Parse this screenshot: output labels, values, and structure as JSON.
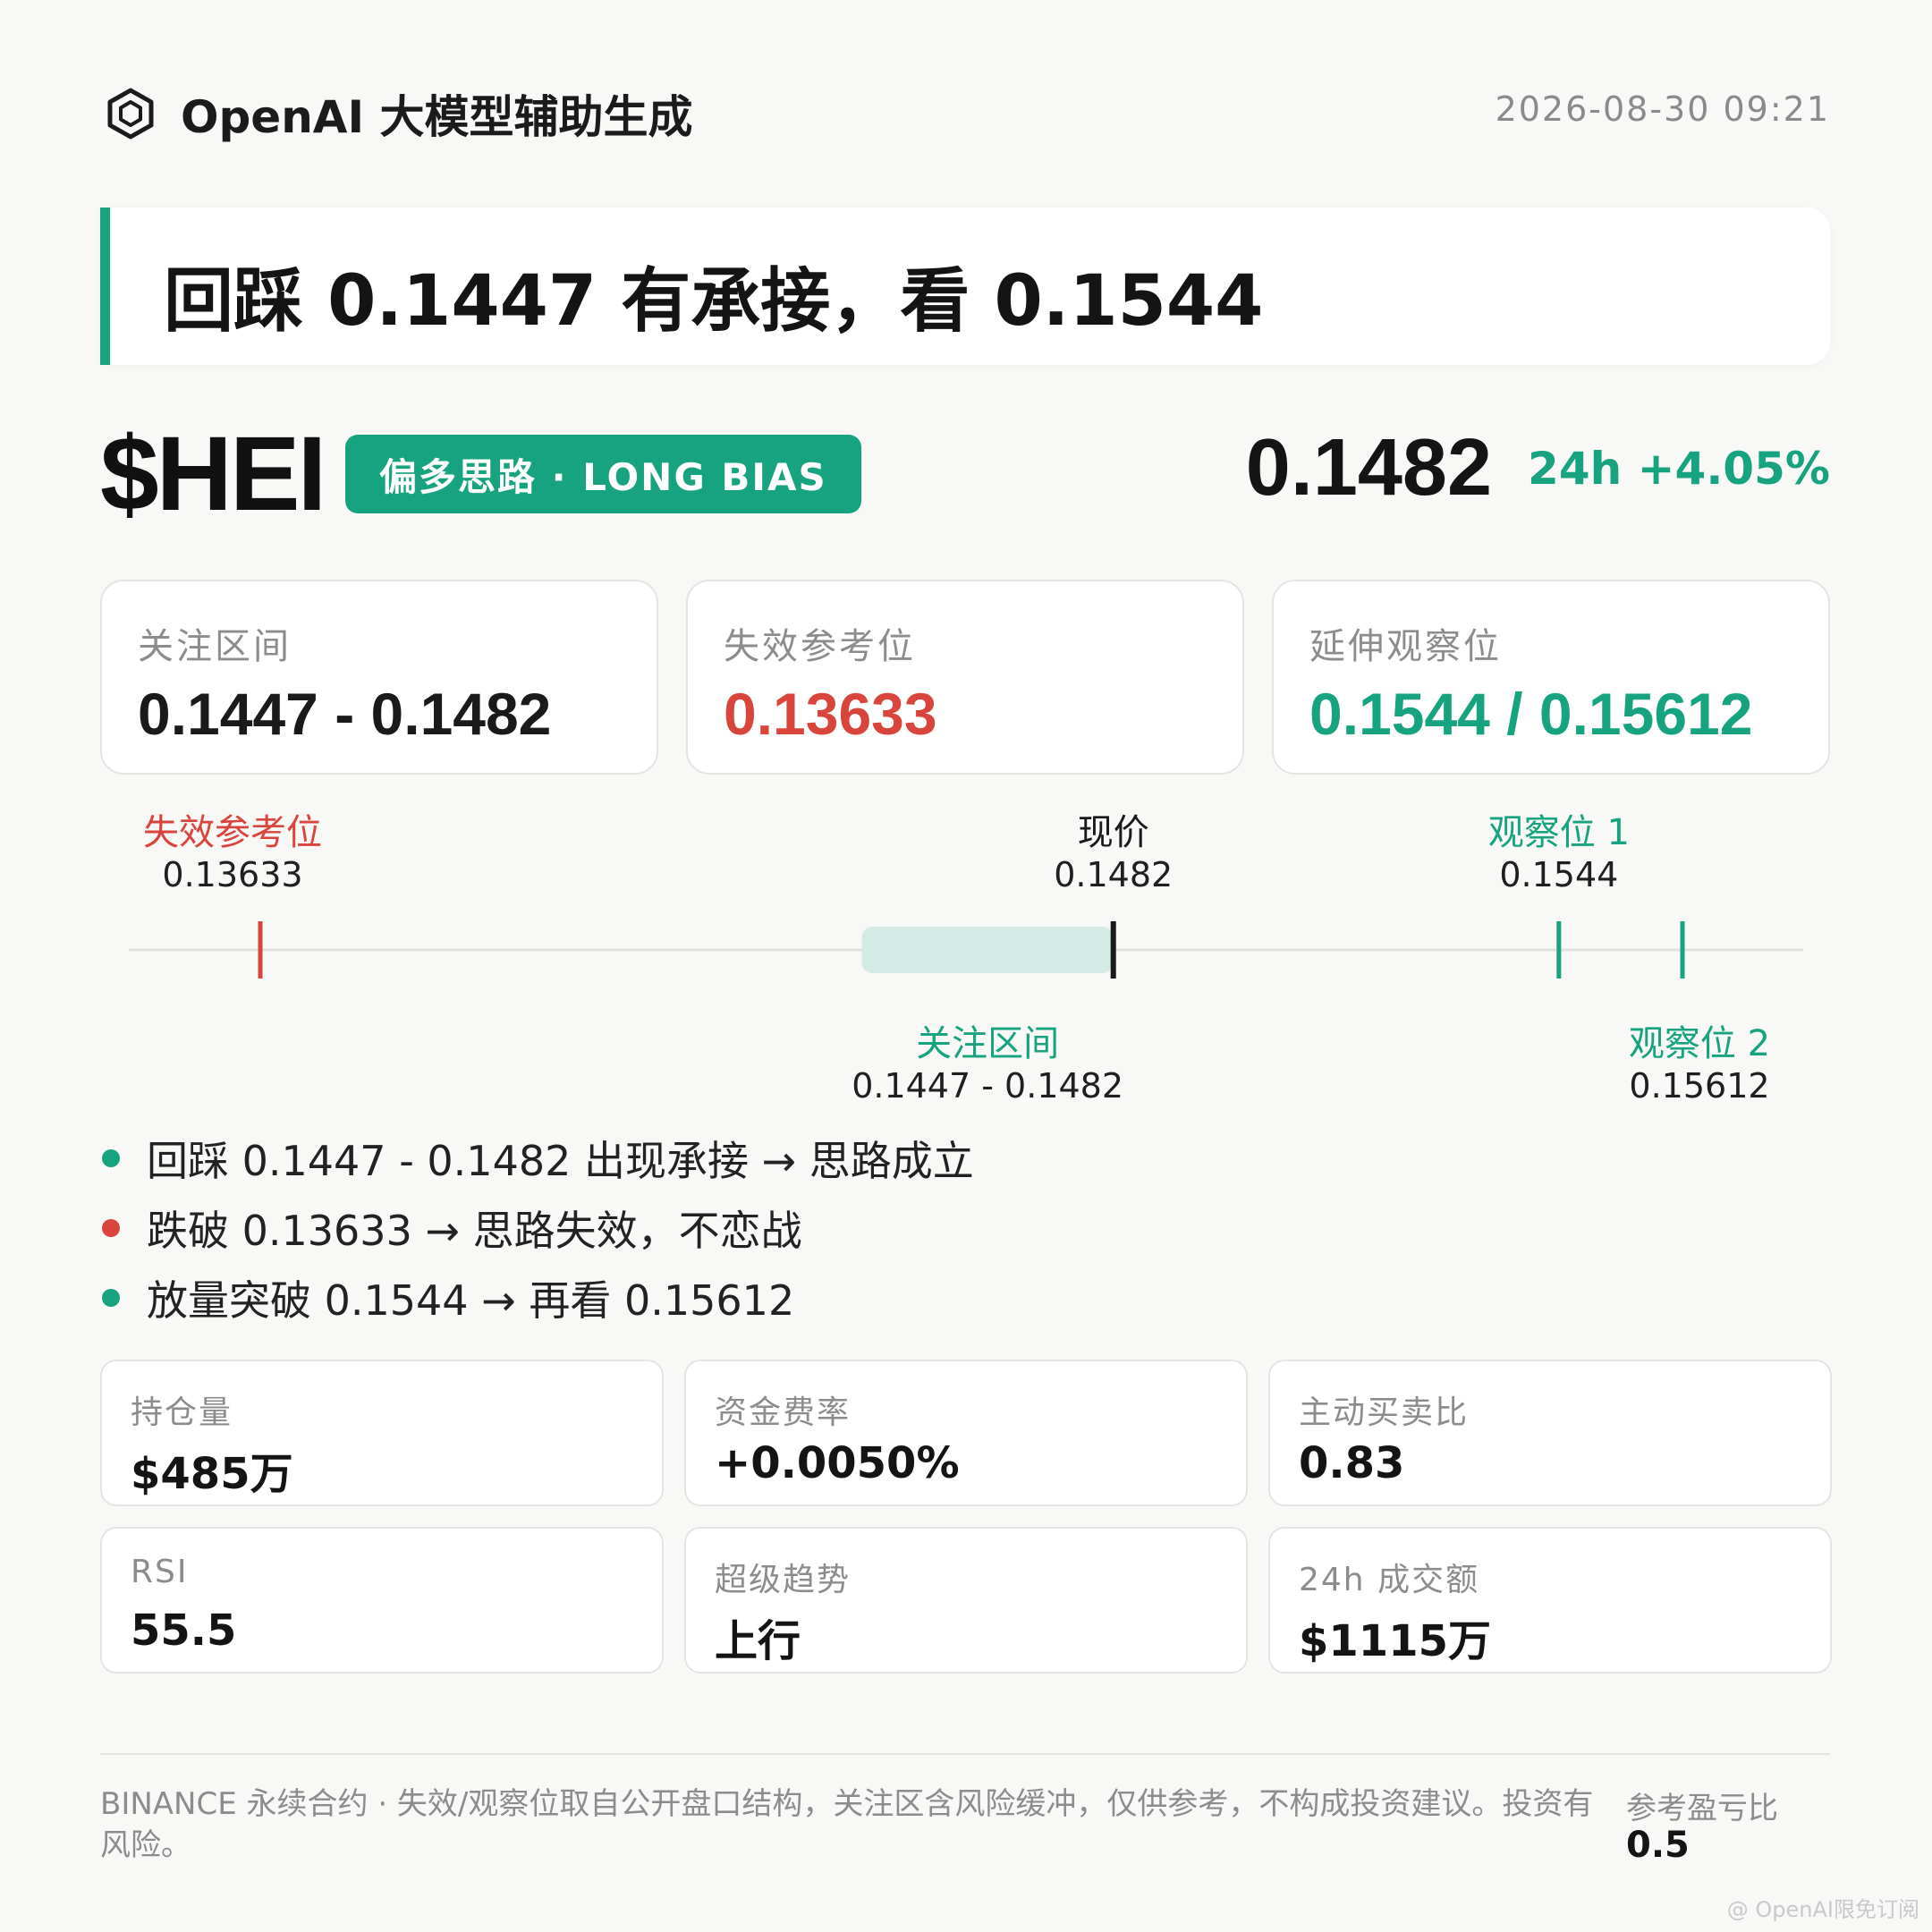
{
  "header": {
    "brand": "OpenAI 大模型辅助生成",
    "brand_icon": "hexagon-logo-icon",
    "datetime": "2026-08-30 09:21"
  },
  "headline": "回踩 0.1447 有承接，看 0.1544",
  "ticker": {
    "symbol": "$HEI",
    "bias": "偏多思路 · LONG BIAS",
    "price": "0.1482",
    "change": "24h +4.05%"
  },
  "levels": [
    {
      "label": "关注区间",
      "value": "0.1447 - 0.1482",
      "color": "#1a1a1a"
    },
    {
      "label": "失效参考位",
      "value": "0.13633",
      "color": "#d9453d"
    },
    {
      "label": "延伸观察位",
      "value": "0.1544 / 0.15612",
      "color": "#17a37f"
    }
  ],
  "range_chart": {
    "scale_min": 0.1345,
    "scale_max": 0.1578,
    "invalidation": {
      "label": "失效参考位",
      "value": "0.13633",
      "price": 0.13633,
      "color": "#d9453d"
    },
    "current": {
      "label": "现价",
      "value": "0.1482",
      "price": 0.1482,
      "color": "#1a1a1a"
    },
    "target1": {
      "label": "观察位 1",
      "value": "0.1544",
      "price": 0.1544,
      "color": "#17a37f"
    },
    "target2": {
      "label": "观察位 2",
      "value": "0.15612",
      "price": 0.15612,
      "color": "#17a37f"
    },
    "zone": {
      "label": "关注区间",
      "value": "0.1447 - 0.1482",
      "from": 0.1447,
      "to": 0.1482,
      "color": "#17a37f"
    }
  },
  "bullets": [
    {
      "text": "回踩 0.1447 - 0.1482 出现承接 → 思路成立",
      "color": "#17a37f"
    },
    {
      "text": "跌破 0.13633 → 思路失效，不恋战",
      "color": "#d9453d"
    },
    {
      "text": "放量突破 0.1544 → 再看 0.15612",
      "color": "#17a37f"
    }
  ],
  "metrics": [
    {
      "label": "持仓量",
      "value": "$485万"
    },
    {
      "label": "资金费率",
      "value": "+0.0050%"
    },
    {
      "label": "主动买卖比",
      "value": "0.83"
    },
    {
      "label": "RSI",
      "value": "55.5"
    },
    {
      "label": "超级趋势",
      "value": "上行"
    },
    {
      "label": "24h 成交额",
      "value": "$1115万"
    }
  ],
  "footer": {
    "disclaimer": "BINANCE 永续合约 · 失效/观察位取自公开盘口结构，关注区含风险缓冲，仅供参考，不构成投资建议。投资有风险。",
    "rr_label": "参考盈亏比",
    "rr_value": "0.5",
    "watermark": "@ OpenAI限免订阅"
  }
}
